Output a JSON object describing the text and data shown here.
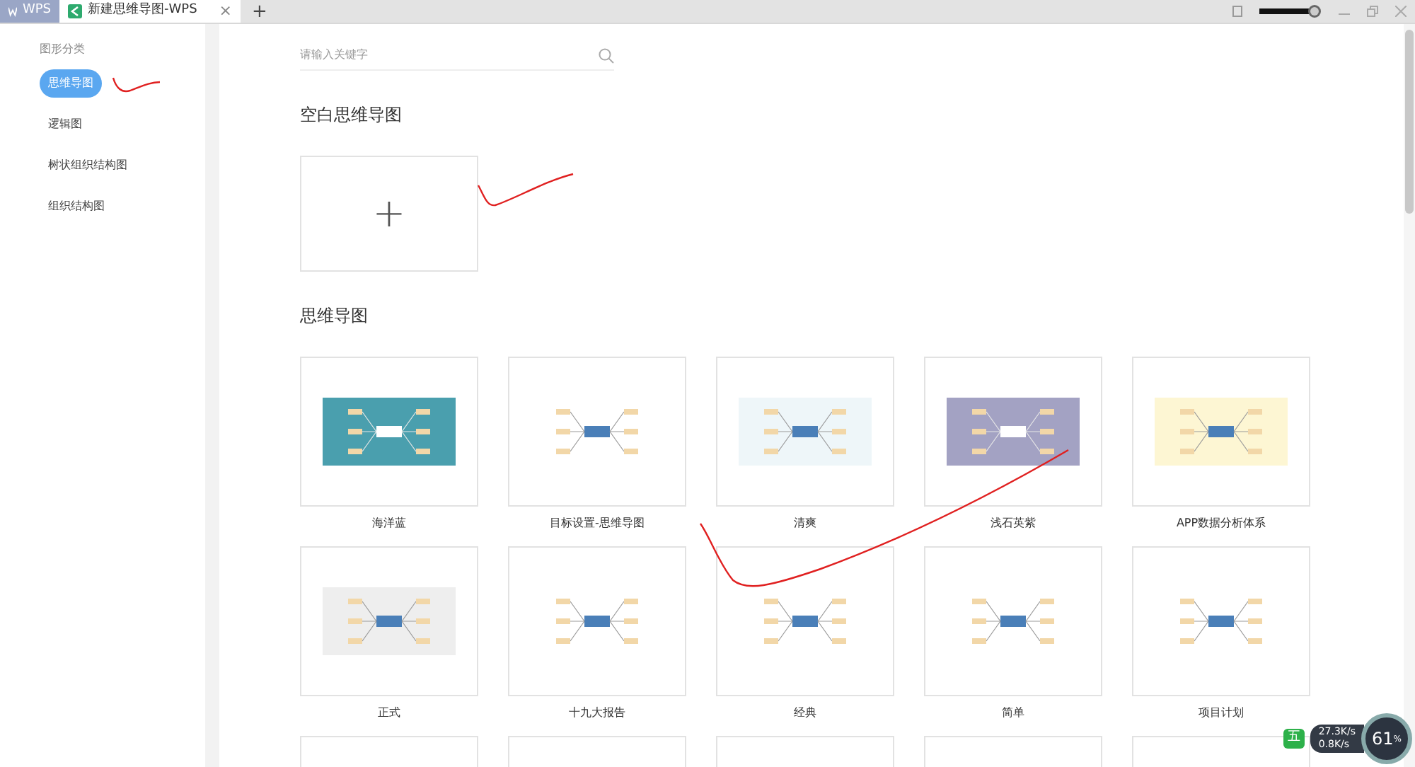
{
  "window": {
    "tabs": [
      {
        "label": "WPS",
        "kind": "home",
        "selected": false
      },
      {
        "label": "新建思维导图-WPS",
        "kind": "doc",
        "selected": true,
        "close": "×"
      }
    ],
    "new_tab": "+"
  },
  "sidebar": {
    "title": "图形分类",
    "items": [
      {
        "label": "思维导图",
        "selected": true
      },
      {
        "label": "逻辑图",
        "selected": false
      },
      {
        "label": "树状组织结构图",
        "selected": false
      },
      {
        "label": "组织结构图",
        "selected": false
      }
    ]
  },
  "search": {
    "placeholder": "请输入关键字"
  },
  "blank_section": {
    "title": "空白思维导图",
    "add": "+"
  },
  "templates_section": {
    "title": "思维导图",
    "templates": [
      {
        "name": "海洋蓝",
        "color": "#4a9fae"
      },
      {
        "name": "目标设置-思维导图"
      },
      {
        "name": "清爽",
        "color": "#eef6f9"
      },
      {
        "name": "浅石英紫",
        "color": "#a3a2c3"
      },
      {
        "name": "APP数据分析体系",
        "color": "#fdf6d3"
      },
      {
        "name": "正式",
        "color": "#eeeeee"
      },
      {
        "name": "十九大报告"
      },
      {
        "name": "经典"
      },
      {
        "name": "简单"
      },
      {
        "name": "项目计划"
      },
      {
        "kind": "partial"
      },
      {
        "kind": "partial"
      },
      {
        "kind": "partial"
      },
      {
        "kind": "partial"
      },
      {
        "kind": "partial"
      }
    ]
  },
  "tray": {
    "upload": "27.3K/s",
    "download": "0.8K/s",
    "percent": "61",
    "unit": "%",
    "ime": "五"
  }
}
